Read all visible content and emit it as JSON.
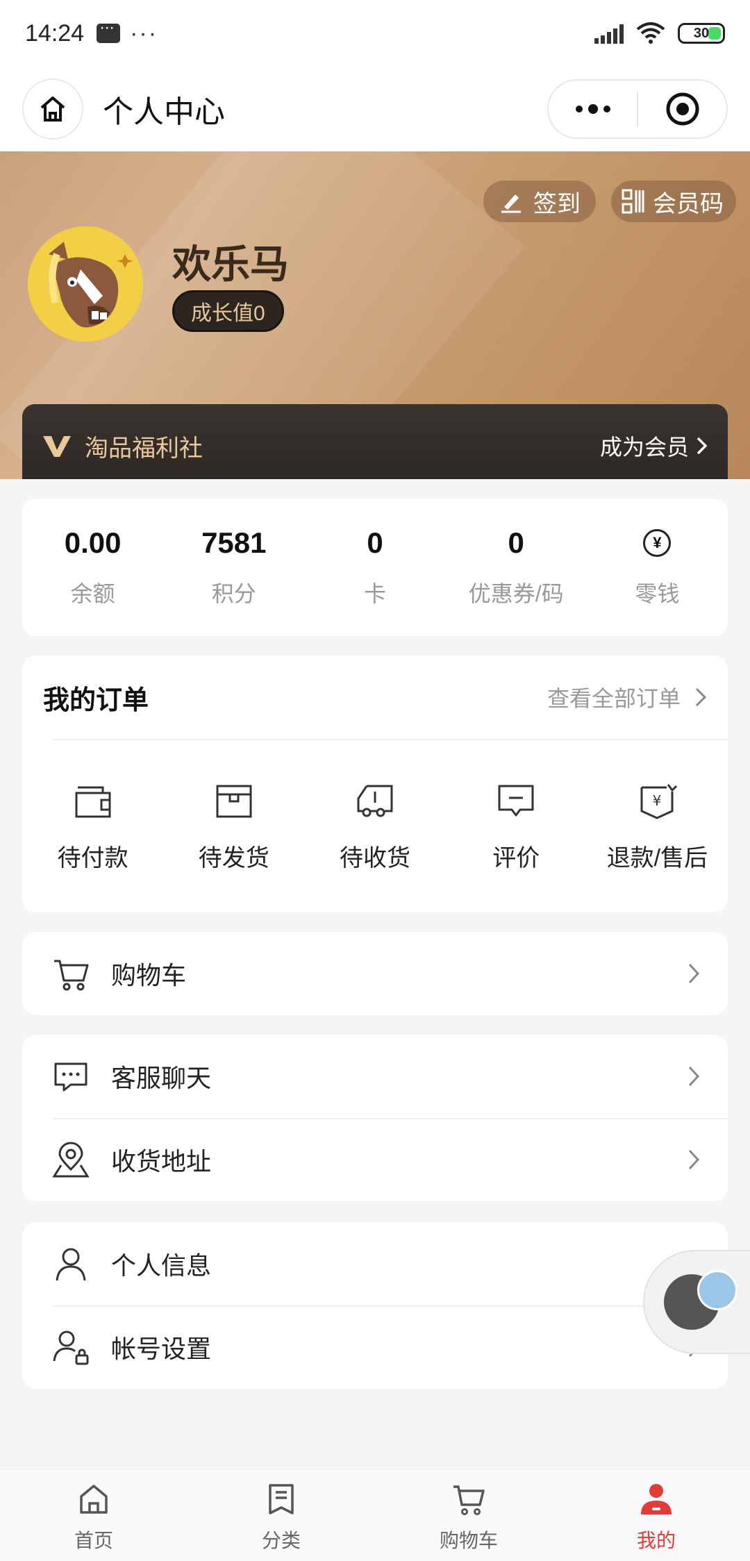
{
  "status_bar": {
    "time": "14:24",
    "battery": "30"
  },
  "nav": {
    "title": "个人中心"
  },
  "profile": {
    "name": "欢乐马",
    "growth": "成长值0",
    "checkin_label": "签到",
    "member_code_label": "会员码"
  },
  "vip": {
    "name": "淘品福利社",
    "join_label": "成为会员"
  },
  "stats": [
    {
      "value": "0.00",
      "label": "余额"
    },
    {
      "value": "7581",
      "label": "积分"
    },
    {
      "value": "0",
      "label": "卡"
    },
    {
      "value": "0",
      "label": "优惠券/码"
    },
    {
      "value": "",
      "label": "零钱",
      "icon": "yen-icon"
    }
  ],
  "orders": {
    "title": "我的订单",
    "view_all": "查看全部订单",
    "items": [
      {
        "label": "待付款",
        "icon": "wallet-icon"
      },
      {
        "label": "待发货",
        "icon": "box-icon"
      },
      {
        "label": "待收货",
        "icon": "truck-icon"
      },
      {
        "label": "评价",
        "icon": "comment-icon"
      },
      {
        "label": "退款/售后",
        "icon": "refund-icon"
      }
    ]
  },
  "menu": {
    "cart": "购物车",
    "service": "客服聊天",
    "address": "收货地址",
    "profile": "个人信息",
    "account": "帐号设置"
  },
  "tabs": [
    {
      "label": "首页",
      "icon": "home-icon"
    },
    {
      "label": "分类",
      "icon": "category-icon"
    },
    {
      "label": "购物车",
      "icon": "cart-icon"
    },
    {
      "label": "我的",
      "icon": "user-icon",
      "active": true
    }
  ],
  "colors": {
    "accent": "#e33a3a",
    "gold": "#e9c99a",
    "header": "#c9a27c"
  }
}
